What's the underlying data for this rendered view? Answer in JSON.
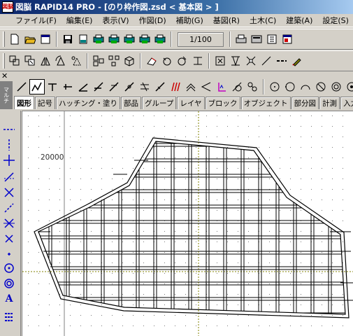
{
  "window": {
    "title": "図脳 RAPID14 PRO - [のり枠作図.zsd  < 基本図 > ]",
    "app_icon_text": "図脳"
  },
  "menu": [
    "ファイル(F)",
    "編集(E)",
    "表示(V)",
    "作図(D)",
    "補助(G)",
    "基図(R)",
    "土木(C)",
    "建築(A)",
    "設定(S)"
  ],
  "toolbar": {
    "scale_value": "1/100"
  },
  "palette_tabs": [
    "図形",
    "記号",
    "ハッチング・塗り",
    "部品",
    "グループ",
    "レイヤ",
    "ブロック",
    "オブジェクト",
    "部分図",
    "計測",
    "入力属性"
  ],
  "active_tab": "図形",
  "side_tab_label": "マルチ",
  "canvas": {
    "coordinate_label": "20000"
  },
  "colors": {
    "titlebar": "#0a246a",
    "canvas": "#ffffff",
    "axis": "#808000",
    "face": "#d4d0c8"
  },
  "icons": {
    "toolbar1": [
      "new-icon",
      "open-icon",
      "layer-icon",
      "save-icon",
      "print-icon",
      "print-preview-icon",
      "plot-icon",
      "plot2-icon",
      "plot3-icon",
      "zoom-icon",
      "scale-icon",
      "print-setup-icon",
      "memo-icon",
      "grid-icon"
    ],
    "toolbar2": [
      "copy-icon",
      "move-icon",
      "mirror-icon",
      "rotate-icon",
      "scale-shape-icon",
      "group-icon",
      "explode-icon",
      "block-icon",
      "erase-icon",
      "undo-icon",
      "redo-icon",
      "snap-icon",
      "dimension-icon",
      "measure-icon",
      "hatch-icon",
      "line-style-icon",
      "line-type-icon",
      "pen-icon"
    ],
    "drawbar": [
      "line-icon",
      "polyline-icon",
      "perpendicular-icon",
      "parallel-icon",
      "angle-line-icon",
      "tangent-icon",
      "extend-icon",
      "offset-icon",
      "hatching-icon",
      "chamfer-icon",
      "fillet-icon",
      "break-icon",
      "trim-icon",
      "join-icon",
      "circle-icon",
      "arc-icon",
      "ellipse-icon",
      "donut-icon",
      "concentric-icon",
      "point-icon"
    ],
    "lefttools": [
      "dashed-h-icon",
      "dashed-v-icon",
      "cross-icon",
      "diagonal-icon",
      "diag-cross-icon",
      "diag-dash-icon",
      "diag-cross2-icon",
      "x-mark-icon",
      "plus-small-icon",
      "target-icon",
      "double-circle-icon",
      "text-icon",
      "list-icon"
    ]
  }
}
